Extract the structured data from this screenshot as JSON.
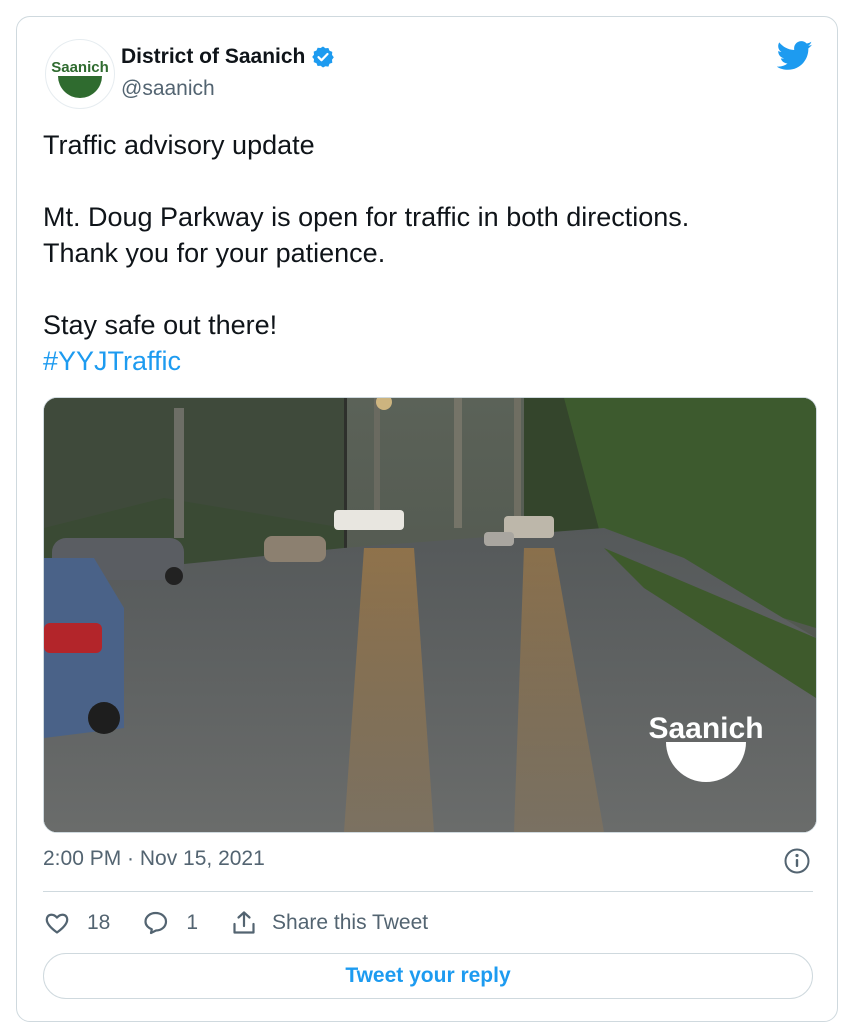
{
  "author": {
    "display_name": "District of Saanich",
    "handle": "@saanich",
    "avatar_label": "Saanich",
    "verified": true
  },
  "tweet": {
    "lines": [
      "Traffic advisory update",
      "Mt. Doug Parkway is open for traffic in both directions.",
      "Thank you for your patience.",
      "Stay safe out there!"
    ],
    "hashtag": "#YYJTraffic"
  },
  "media": {
    "watermark": "Saanich"
  },
  "meta": {
    "timestamp": "2:00 PM · Nov 15, 2021"
  },
  "actions": {
    "like_count": "18",
    "reply_count": "1",
    "share_label": "Share this Tweet"
  },
  "reply_button": {
    "label": "Tweet your reply"
  },
  "colors": {
    "accent": "#1d9bf0",
    "secondary_text": "#536471",
    "border": "#cfd9de",
    "brand_green": "#2f6b2f"
  }
}
